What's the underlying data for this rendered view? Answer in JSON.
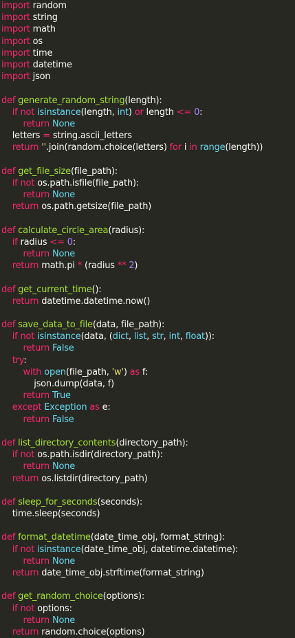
{
  "editor": {
    "background": "#272822",
    "colors": {
      "keyword": "#f92672",
      "function": "#a6e22e",
      "builtin": "#66d9ef",
      "number": "#ae81ff",
      "string": "#e6db74",
      "plain": "#f8f8f2"
    },
    "lines": [
      [
        [
          "keyword",
          "import"
        ],
        [
          "plain",
          " random"
        ]
      ],
      [
        [
          "keyword",
          "import"
        ],
        [
          "plain",
          " string"
        ]
      ],
      [
        [
          "keyword",
          "import"
        ],
        [
          "plain",
          " math"
        ]
      ],
      [
        [
          "keyword",
          "import"
        ],
        [
          "plain",
          " os"
        ]
      ],
      [
        [
          "keyword",
          "import"
        ],
        [
          "plain",
          " time"
        ]
      ],
      [
        [
          "keyword",
          "import"
        ],
        [
          "plain",
          " datetime"
        ]
      ],
      [
        [
          "keyword",
          "import"
        ],
        [
          "plain",
          " json"
        ]
      ],
      [],
      [
        [
          "keyword",
          "def"
        ],
        [
          "plain",
          " "
        ],
        [
          "func",
          "generate_random_string"
        ],
        [
          "plain",
          "(length):"
        ]
      ],
      [
        [
          "plain",
          "    "
        ],
        [
          "keyword",
          "if not"
        ],
        [
          "plain",
          " "
        ],
        [
          "builtin",
          "isinstance"
        ],
        [
          "plain",
          "(length, "
        ],
        [
          "builtin",
          "int"
        ],
        [
          "plain",
          ") "
        ],
        [
          "keyword",
          "or"
        ],
        [
          "plain",
          " length "
        ],
        [
          "op",
          "<="
        ],
        [
          "plain",
          " "
        ],
        [
          "number",
          "0"
        ],
        [
          "plain",
          ":"
        ]
      ],
      [
        [
          "plain",
          "        "
        ],
        [
          "keyword",
          "return"
        ],
        [
          "plain",
          " "
        ],
        [
          "builtin",
          "None"
        ]
      ],
      [
        [
          "plain",
          "    letters "
        ],
        [
          "op",
          "="
        ],
        [
          "plain",
          " string.ascii_letters"
        ]
      ],
      [
        [
          "plain",
          "    "
        ],
        [
          "keyword",
          "return"
        ],
        [
          "plain",
          " "
        ],
        [
          "string",
          "''"
        ],
        [
          "plain",
          "."
        ],
        [
          "plain",
          "join(random.choice(letters) "
        ],
        [
          "keyword",
          "for"
        ],
        [
          "plain",
          " i "
        ],
        [
          "keyword",
          "in"
        ],
        [
          "plain",
          " "
        ],
        [
          "builtin",
          "range"
        ],
        [
          "plain",
          "(length))"
        ]
      ],
      [],
      [
        [
          "keyword",
          "def"
        ],
        [
          "plain",
          " "
        ],
        [
          "func",
          "get_file_size"
        ],
        [
          "plain",
          "(file_path):"
        ]
      ],
      [
        [
          "plain",
          "    "
        ],
        [
          "keyword",
          "if not"
        ],
        [
          "plain",
          " os.path.isfile(file_path):"
        ]
      ],
      [
        [
          "plain",
          "        "
        ],
        [
          "keyword",
          "return"
        ],
        [
          "plain",
          " "
        ],
        [
          "builtin",
          "None"
        ]
      ],
      [
        [
          "plain",
          "    "
        ],
        [
          "keyword",
          "return"
        ],
        [
          "plain",
          " os.path.getsize(file_path)"
        ]
      ],
      [],
      [
        [
          "keyword",
          "def"
        ],
        [
          "plain",
          " "
        ],
        [
          "func",
          "calculate_circle_area"
        ],
        [
          "plain",
          "(radius):"
        ]
      ],
      [
        [
          "plain",
          "    "
        ],
        [
          "keyword",
          "if"
        ],
        [
          "plain",
          " radius "
        ],
        [
          "op",
          "<="
        ],
        [
          "plain",
          " "
        ],
        [
          "number",
          "0"
        ],
        [
          "plain",
          ":"
        ]
      ],
      [
        [
          "plain",
          "        "
        ],
        [
          "keyword",
          "return"
        ],
        [
          "plain",
          " "
        ],
        [
          "builtin",
          "None"
        ]
      ],
      [
        [
          "plain",
          "    "
        ],
        [
          "keyword",
          "return"
        ],
        [
          "plain",
          " math.pi "
        ],
        [
          "op",
          "*"
        ],
        [
          "plain",
          " (radius "
        ],
        [
          "op",
          "**"
        ],
        [
          "plain",
          " "
        ],
        [
          "number",
          "2"
        ],
        [
          "plain",
          ")"
        ]
      ],
      [],
      [
        [
          "keyword",
          "def"
        ],
        [
          "plain",
          " "
        ],
        [
          "func",
          "get_current_time"
        ],
        [
          "plain",
          "():"
        ]
      ],
      [
        [
          "plain",
          "    "
        ],
        [
          "keyword",
          "return"
        ],
        [
          "plain",
          " datetime.datetime.now()"
        ]
      ],
      [],
      [
        [
          "keyword",
          "def"
        ],
        [
          "plain",
          " "
        ],
        [
          "func",
          "save_data_to_file"
        ],
        [
          "plain",
          "(data, file_path):"
        ]
      ],
      [
        [
          "plain",
          "    "
        ],
        [
          "keyword",
          "if not"
        ],
        [
          "plain",
          " "
        ],
        [
          "builtin",
          "isinstance"
        ],
        [
          "plain",
          "(data, ("
        ],
        [
          "builtin",
          "dict"
        ],
        [
          "plain",
          ", "
        ],
        [
          "builtin",
          "list"
        ],
        [
          "plain",
          ", "
        ],
        [
          "builtin",
          "str"
        ],
        [
          "plain",
          ", "
        ],
        [
          "builtin",
          "int"
        ],
        [
          "plain",
          ", "
        ],
        [
          "builtin",
          "float"
        ],
        [
          "plain",
          ")):"
        ]
      ],
      [
        [
          "plain",
          "        "
        ],
        [
          "keyword",
          "return"
        ],
        [
          "plain",
          " "
        ],
        [
          "builtin",
          "False"
        ]
      ],
      [
        [
          "plain",
          "    "
        ],
        [
          "keyword",
          "try"
        ],
        [
          "plain",
          ":"
        ]
      ],
      [
        [
          "plain",
          "        "
        ],
        [
          "keyword",
          "with"
        ],
        [
          "plain",
          " "
        ],
        [
          "builtin",
          "open"
        ],
        [
          "plain",
          "(file_path, "
        ],
        [
          "string",
          "'w'"
        ],
        [
          "plain",
          ") "
        ],
        [
          "keyword",
          "as"
        ],
        [
          "plain",
          " f:"
        ]
      ],
      [
        [
          "plain",
          "            json.dump(data, f)"
        ]
      ],
      [
        [
          "plain",
          "        "
        ],
        [
          "keyword",
          "return"
        ],
        [
          "plain",
          " "
        ],
        [
          "builtin",
          "True"
        ]
      ],
      [
        [
          "plain",
          "    "
        ],
        [
          "keyword",
          "except"
        ],
        [
          "plain",
          " "
        ],
        [
          "builtin",
          "Exception"
        ],
        [
          "plain",
          " "
        ],
        [
          "keyword",
          "as"
        ],
        [
          "plain",
          " e:"
        ]
      ],
      [
        [
          "plain",
          "        "
        ],
        [
          "keyword",
          "return"
        ],
        [
          "plain",
          " "
        ],
        [
          "builtin",
          "False"
        ]
      ],
      [],
      [
        [
          "keyword",
          "def"
        ],
        [
          "plain",
          " "
        ],
        [
          "func",
          "list_directory_contents"
        ],
        [
          "plain",
          "(directory_path):"
        ]
      ],
      [
        [
          "plain",
          "    "
        ],
        [
          "keyword",
          "if not"
        ],
        [
          "plain",
          " os.path.isdir(directory_path):"
        ]
      ],
      [
        [
          "plain",
          "        "
        ],
        [
          "keyword",
          "return"
        ],
        [
          "plain",
          " "
        ],
        [
          "builtin",
          "None"
        ]
      ],
      [
        [
          "plain",
          "    "
        ],
        [
          "keyword",
          "return"
        ],
        [
          "plain",
          " os.listdir(directory_path)"
        ]
      ],
      [],
      [
        [
          "keyword",
          "def"
        ],
        [
          "plain",
          " "
        ],
        [
          "func",
          "sleep_for_seconds"
        ],
        [
          "plain",
          "(seconds):"
        ]
      ],
      [
        [
          "plain",
          "    time.sleep(seconds)"
        ]
      ],
      [],
      [
        [
          "keyword",
          "def"
        ],
        [
          "plain",
          " "
        ],
        [
          "func",
          "format_datetime"
        ],
        [
          "plain",
          "(date_time_obj, format_string):"
        ]
      ],
      [
        [
          "plain",
          "    "
        ],
        [
          "keyword",
          "if not"
        ],
        [
          "plain",
          " "
        ],
        [
          "builtin",
          "isinstance"
        ],
        [
          "plain",
          "(date_time_obj, datetime.datetime):"
        ]
      ],
      [
        [
          "plain",
          "        "
        ],
        [
          "keyword",
          "return"
        ],
        [
          "plain",
          " "
        ],
        [
          "builtin",
          "None"
        ]
      ],
      [
        [
          "plain",
          "    "
        ],
        [
          "keyword",
          "return"
        ],
        [
          "plain",
          " date_time_obj.strftime(format_string)"
        ]
      ],
      [],
      [
        [
          "keyword",
          "def"
        ],
        [
          "plain",
          " "
        ],
        [
          "func",
          "get_random_choice"
        ],
        [
          "plain",
          "(options):"
        ]
      ],
      [
        [
          "plain",
          "    "
        ],
        [
          "keyword",
          "if not"
        ],
        [
          "plain",
          " options:"
        ]
      ],
      [
        [
          "plain",
          "        "
        ],
        [
          "keyword",
          "return"
        ],
        [
          "plain",
          " "
        ],
        [
          "builtin",
          "None"
        ]
      ],
      [
        [
          "plain",
          "    "
        ],
        [
          "keyword",
          "return"
        ],
        [
          "plain",
          " random.choice(options)"
        ]
      ]
    ]
  }
}
